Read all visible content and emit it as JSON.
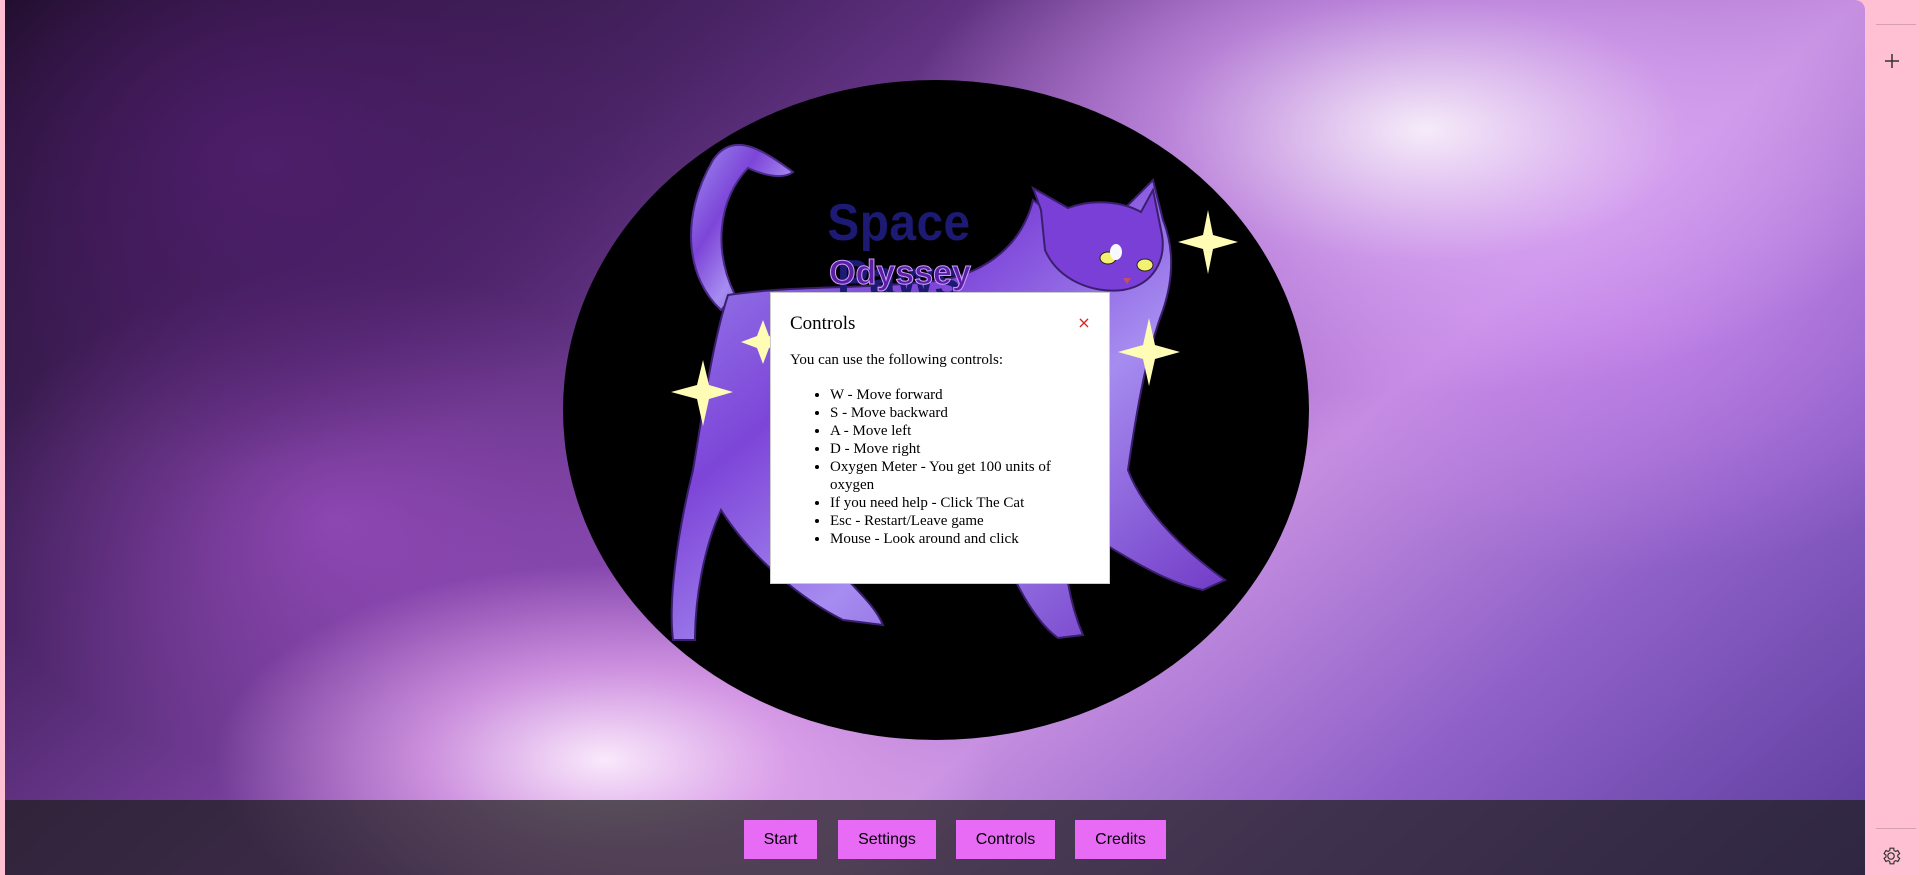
{
  "game": {
    "title": "Space Paws",
    "subtitle": "Odyssey"
  },
  "controls_dialog": {
    "title": "Controls",
    "close_label": "×",
    "intro": "You can use the following controls:",
    "items": [
      "W - Move forward",
      "S - Move backward",
      "A - Move left",
      "D - Move right",
      "Oxygen Meter - You get 100 units of oxygen",
      "If you need help - Click The Cat",
      "Esc - Restart/Leave game",
      "Mouse - Look around and click"
    ]
  },
  "menu": {
    "start": "Start",
    "settings": "Settings",
    "controls": "Controls",
    "credits": "Credits"
  },
  "side_panel": {
    "add_icon": "plus-icon",
    "settings_icon": "gear-icon"
  },
  "colors": {
    "menu_button": "#e86bf5",
    "title_text": "#1d1a74",
    "subtitle_text": "#5b1fa3",
    "side_panel": "#ffc0d3",
    "close_x": "#e02020"
  }
}
